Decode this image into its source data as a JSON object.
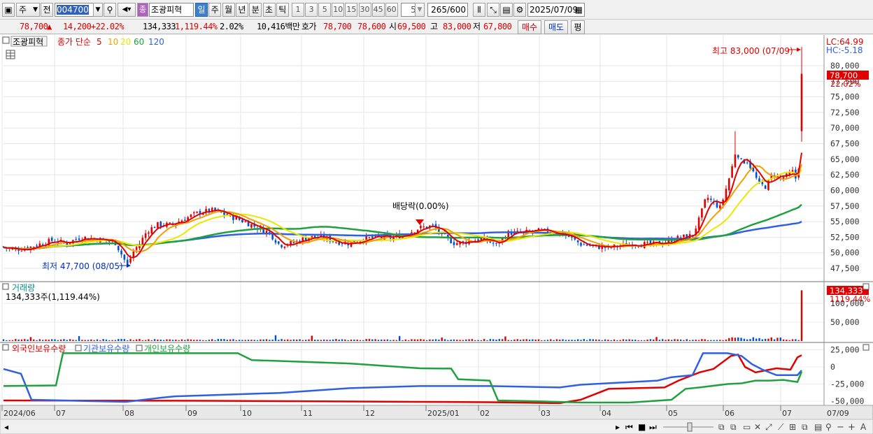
{
  "toolbar": {
    "market": "주",
    "prefix": "전",
    "code": "004700",
    "name_badge": "종",
    "stock_name": "조광피혁",
    "periods": [
      "일",
      "주",
      "월",
      "년",
      "분",
      "초",
      "틱"
    ],
    "active_period": "일",
    "intervals": [
      "1",
      "3",
      "5",
      "10",
      "15",
      "30",
      "45",
      "60"
    ],
    "count_value": "5",
    "display_count": "265",
    "display_total": "/600",
    "date": "2025/07/09"
  },
  "quote": {
    "price": "78,700",
    "change_arrow": "▲",
    "change": "14,200",
    "change_pct": "+22.02%",
    "volume": "134,333",
    "volume_ratio": "1,119.44%",
    "turnover": "2.02%",
    "amount": "10,416백만",
    "hoga_label": "호가",
    "ask": "78,700",
    "bid": "78,600",
    "open_label": "시",
    "open": "69,500",
    "high_label": "고",
    "high": "83,000",
    "low_label": "저",
    "low": "67,800",
    "buy_button": "매수",
    "sell_button": "매도",
    "eval_button": "평"
  },
  "price_panel": {
    "title": "조광피혁",
    "ma_label": "종가 단순",
    "ma_periods": [
      "5",
      "10",
      "20",
      "60",
      "120"
    ],
    "ma_colors": [
      "#e00000",
      "#f0a000",
      "#e8e800",
      "#20a040",
      "#3060e0"
    ],
    "lc": "LC:64.99",
    "hc": "HC:-5.18",
    "high_annotation": "최고 83,000 (07/09)",
    "low_annotation": "최저 47,700 (08/05)",
    "dividend_annotation": "배당락(0.00%)",
    "last_price_tag": "78,700",
    "last_pct_tag": "22.02%",
    "y_ticks": [
      "80,000",
      "77,500",
      "75,000",
      "72,500",
      "70,000",
      "67,500",
      "65,000",
      "62,500",
      "60,000",
      "57,500",
      "55,000",
      "52,500",
      "50,000",
      "47,500"
    ]
  },
  "volume_panel": {
    "title": "거래량",
    "value_label": "134,333주(1,119.44%)",
    "tag_value": "134,333",
    "tag_pct": "1119.44%",
    "y_ticks": [
      "100,000",
      "50,000"
    ]
  },
  "holding_panel": {
    "legend": [
      "외국인보유수량",
      "기관보유수량",
      "개인보유수량"
    ],
    "legend_colors": [
      "#e00000",
      "#3060e0",
      "#20a040"
    ],
    "y_ticks": [
      "25,000",
      "0",
      "-25,000",
      "-50,000"
    ]
  },
  "x_axis": {
    "labels": [
      "2024/06",
      "07",
      "08",
      "09",
      "10",
      "11",
      "12",
      "2025/01",
      "02",
      "03",
      "04",
      "05",
      "06",
      "07",
      "07/09"
    ]
  },
  "chart_data": {
    "type": "candlestick",
    "period": "daily",
    "x_range": [
      "2024/06",
      "2025/07/09"
    ],
    "price_ylim": [
      47500,
      80000
    ],
    "close_series": [
      {
        "x": "2024/06",
        "close": 51000
      },
      {
        "x": "2024/07",
        "close": 51500
      },
      {
        "x": "2024/08/05",
        "close": 48000
      },
      {
        "x": "2024/08",
        "close": 53500
      },
      {
        "x": "2024/09",
        "close": 56500
      },
      {
        "x": "2024/10",
        "close": 55000
      },
      {
        "x": "2024/11",
        "close": 52000
      },
      {
        "x": "2024/12",
        "close": 52000
      },
      {
        "x": "2025/01",
        "close": 54000
      },
      {
        "x": "2025/02",
        "close": 52000
      },
      {
        "x": "2025/03",
        "close": 53000
      },
      {
        "x": "2025/04",
        "close": 51000
      },
      {
        "x": "2025/05",
        "close": 52500
      },
      {
        "x": "2025/06",
        "close": 64000
      },
      {
        "x": "2025/07",
        "close": 62500
      },
      {
        "x": "2025/07/09",
        "close": 78700
      }
    ],
    "high": {
      "value": 83000,
      "date": "07/09"
    },
    "low": {
      "value": 47700,
      "date": "08/05"
    },
    "volume_series": [
      {
        "x": "2024/07",
        "value": 15000
      },
      {
        "x": "2024/12",
        "value": 12000
      },
      {
        "x": "2025/02",
        "value": 12000
      },
      {
        "x": "2025/06",
        "value": 10000
      },
      {
        "x": "2025/07/09",
        "value": 134333
      }
    ],
    "holding_series": [
      {
        "name": "외국인보유수량",
        "values": [
          -50000,
          -50000,
          -52000,
          -50000,
          -45000,
          -42000,
          -30000,
          -25000,
          -12000,
          20000,
          -5000,
          18000
        ]
      },
      {
        "name": "기관보유수량",
        "values": [
          0,
          -50000,
          -50000,
          -45000,
          -40000,
          -35000,
          -30000,
          -28000,
          -25000,
          20000,
          0,
          -10000
        ]
      },
      {
        "name": "개인보유수량",
        "values": [
          -30000,
          20000,
          20000,
          20000,
          5000,
          -20000,
          -50000,
          -55000,
          -50000,
          -30000,
          -20000,
          -10000
        ]
      }
    ]
  }
}
